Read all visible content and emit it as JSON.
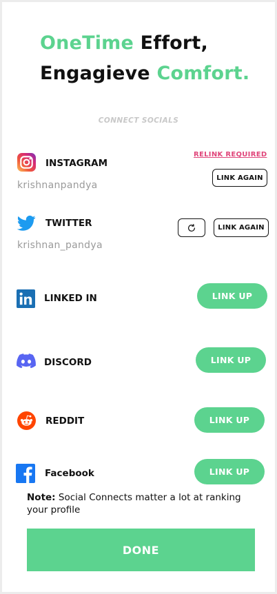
{
  "headline": {
    "line1_green": "OneTime",
    "line1_black": "Effort,",
    "line2_black": "Engagieve",
    "line2_green": "Comfort."
  },
  "section_title": "CONNECT SOCIALS",
  "accounts": [
    {
      "name": "INSTAGRAM",
      "icon": "instagram-icon",
      "handle": "krishnanpandya",
      "status": "RELINK REQUIRED",
      "button": "LINK AGAIN"
    },
    {
      "name": "TWITTER",
      "icon": "twitter-icon",
      "handle": "krishnan_pandya",
      "refresh_icon": "refresh-icon",
      "button": "LINK AGAIN"
    },
    {
      "name": "LINKED IN",
      "icon": "linkedin-icon",
      "button": "LINK UP"
    },
    {
      "name": "DISCORD",
      "icon": "discord-icon",
      "button": "LINK UP"
    },
    {
      "name": "REDDIT",
      "icon": "reddit-icon",
      "button": "LINK UP"
    },
    {
      "name": "Facebook",
      "icon": "facebook-icon",
      "button": "LINK UP"
    }
  ],
  "note": {
    "label": "Note:",
    "text": "Social Connects matter a lot at ranking your profile"
  },
  "done_label": "DONE",
  "colors": {
    "accent_green": "#5cd38f",
    "relink_pink": "#e0457a",
    "handle_gray": "#9a9a9a"
  }
}
